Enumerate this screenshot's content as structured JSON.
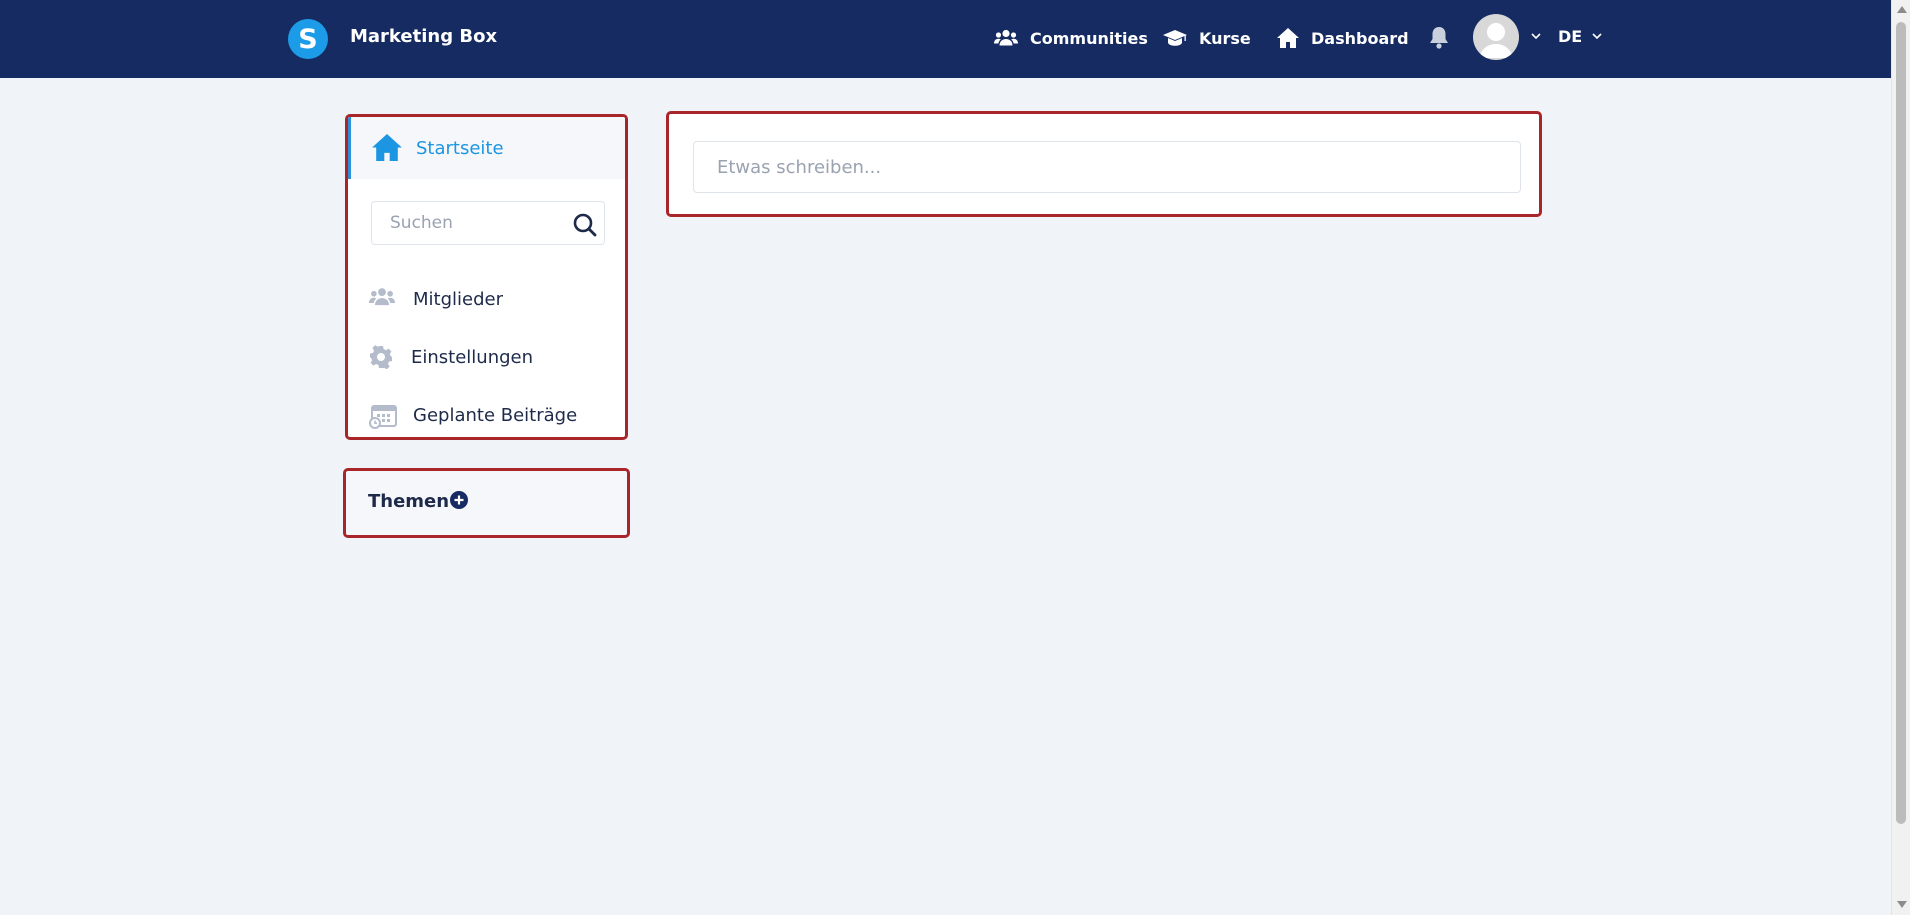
{
  "header": {
    "logo_letter": "S",
    "app_title": "Marketing Box",
    "nav": [
      {
        "label": "Communities",
        "icon": "users-icon"
      },
      {
        "label": "Kurse",
        "icon": "graduation-cap-icon"
      },
      {
        "label": "Dashboard",
        "icon": "home-icon"
      }
    ],
    "language": "DE"
  },
  "sidebar": {
    "home_label": "Startseite",
    "search_placeholder": "Suchen",
    "items": [
      {
        "label": "Mitglieder",
        "icon": "members-icon"
      },
      {
        "label": "Einstellungen",
        "icon": "gear-icon"
      },
      {
        "label": "Geplante Beiträge",
        "icon": "calendar-clock-icon"
      }
    ],
    "topics_title": "Themen"
  },
  "composer": {
    "placeholder": "Etwas schreiben..."
  },
  "colors": {
    "header_bg": "#152b61",
    "accent": "#1c96e2",
    "page_bg": "#f0f3f8",
    "highlight_border": "#a8262a"
  }
}
